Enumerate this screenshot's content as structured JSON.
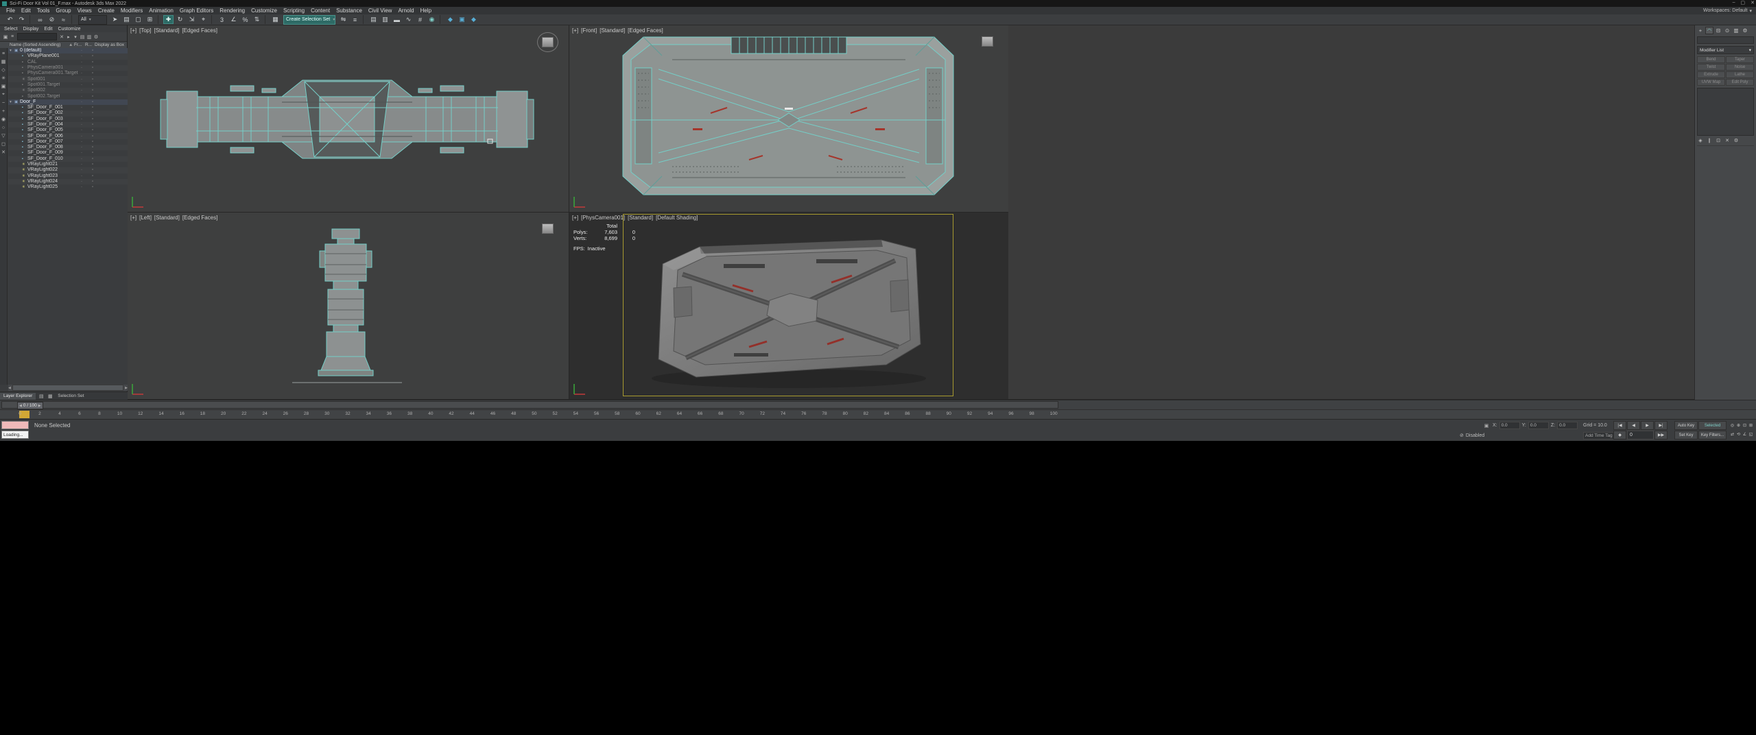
{
  "window": {
    "title": "Sci-Fi Door Kit Vol 01_F.max - Autodesk 3ds Max 2022",
    "min_btn": "–",
    "max_btn": "▢",
    "close_btn": "✕"
  },
  "menubar": {
    "items": [
      "File",
      "Edit",
      "Tools",
      "Group",
      "Views",
      "Create",
      "Modifiers",
      "Animation",
      "Graph Editors",
      "Rendering",
      "Customize",
      "Scripting",
      "Content",
      "Substance",
      "Civil View",
      "Arnold",
      "Help"
    ],
    "workspaces": "Workspaces: Default",
    "workspaces_arrow": "▾"
  },
  "toolbar": {
    "icons_a": [
      {
        "dn": "undo-icon",
        "g": "↶"
      },
      {
        "dn": "redo-icon",
        "g": "↷"
      },
      {
        "dn": "separator",
        "g": "",
        "cls": "sep"
      },
      {
        "dn": "select-and-link-icon",
        "g": "∞"
      },
      {
        "dn": "unlink-selection-icon",
        "g": "⊘"
      },
      {
        "dn": "bind-to-spacewarp-icon",
        "g": "≈"
      },
      {
        "dn": "separator",
        "g": "",
        "cls": "sep"
      }
    ],
    "filter_combo": "All",
    "combo_arrow": "▾",
    "icons_b": [
      {
        "dn": "select-object-icon",
        "g": "➤"
      },
      {
        "dn": "select-by-name-icon",
        "g": "▤"
      },
      {
        "dn": "rectangular-selection-icon",
        "g": "▢"
      },
      {
        "dn": "window-crossing-icon",
        "g": "⊞"
      },
      {
        "dn": "separator",
        "g": "",
        "cls": "sep"
      },
      {
        "dn": "select-and-move-icon",
        "g": "✚",
        "cls": "act"
      },
      {
        "dn": "select-and-rotate-icon",
        "g": "↻"
      },
      {
        "dn": "select-and-scale-icon",
        "g": "⇲"
      },
      {
        "dn": "select-and-place-icon",
        "g": "⌖"
      },
      {
        "dn": "separator",
        "g": "",
        "cls": "sep"
      },
      {
        "dn": "snap-toggle-3d-icon",
        "g": "3"
      },
      {
        "dn": "angle-snap-icon",
        "g": "∠"
      },
      {
        "dn": "percent-snap-icon",
        "g": "%"
      },
      {
        "dn": "spinner-snap-icon",
        "g": "⇅"
      },
      {
        "dn": "separator",
        "g": "",
        "cls": "sep"
      },
      {
        "dn": "edit-named-sets-icon",
        "g": "▦"
      }
    ],
    "selset_combo": "Create Selection Set",
    "icons_c": [
      {
        "dn": "mirror-icon",
        "g": "⇋"
      },
      {
        "dn": "align-icon",
        "g": "≡"
      },
      {
        "dn": "separator",
        "g": "",
        "cls": "sep"
      },
      {
        "dn": "scene-explorer-toggle-icon",
        "g": "▤"
      },
      {
        "dn": "layer-explorer-toggle-icon",
        "g": "▥"
      },
      {
        "dn": "ribbon-toggle-icon",
        "g": "▬"
      },
      {
        "dn": "curve-editor-icon",
        "g": "∿"
      },
      {
        "dn": "schematic-view-icon",
        "g": "#"
      },
      {
        "dn": "material-editor-icon",
        "g": "◉",
        "cls": "mat"
      },
      {
        "dn": "separator",
        "g": "",
        "cls": "sep"
      },
      {
        "dn": "render-setup-icon",
        "g": "◆",
        "cls": "rend"
      },
      {
        "dn": "rendered-frame-icon",
        "g": "▣",
        "cls": "rend"
      },
      {
        "dn": "render-production-icon",
        "g": "◆",
        "cls": "rend"
      }
    ]
  },
  "explorer": {
    "menu": [
      "Select",
      "Display",
      "Edit",
      "Customize"
    ],
    "tool_icons_pre": [
      {
        "dn": "explorer-lock-icon",
        "g": "▣"
      },
      {
        "dn": "explorer-sync-icon",
        "g": "≡"
      }
    ],
    "search_value": "",
    "tool_icons_post": [
      {
        "dn": "clear-search-icon",
        "g": "✕"
      },
      {
        "dn": "explorer-expand-icon",
        "g": "▸"
      },
      {
        "dn": "explorer-collapse-icon",
        "g": "▾"
      },
      {
        "dn": "explorer-view-icon",
        "g": "▤"
      },
      {
        "dn": "explorer-columns-icon",
        "g": "▥"
      },
      {
        "dn": "explorer-settings-icon",
        "g": "⚙"
      }
    ],
    "columns": {
      "name": "Name (Sorted Ascending)",
      "sort_arrow": "▲",
      "frozen": "Fr...",
      "render": "R...",
      "display": "Display as Box"
    },
    "side_icons": [
      {
        "dn": "display-all-icon",
        "g": "≡"
      },
      {
        "dn": "display-geometry-icon",
        "g": "▦"
      },
      {
        "dn": "display-shapes-icon",
        "g": "◇"
      },
      {
        "dn": "display-lights-icon",
        "g": "✳"
      },
      {
        "dn": "display-cameras-icon",
        "g": "▣"
      },
      {
        "dn": "display-helpers-icon",
        "g": "⌖"
      },
      {
        "dn": "display-spacewarps-icon",
        "g": "~"
      },
      {
        "dn": "display-groups-icon",
        "g": "+"
      },
      {
        "dn": "display-xrefs-icon",
        "g": "◉"
      },
      {
        "dn": "display-bones-icon",
        "g": "○"
      },
      {
        "dn": "display-containers-icon",
        "g": "▽"
      },
      {
        "dn": "display-materials-icon",
        "g": "◻"
      },
      {
        "dn": "display-none-icon",
        "g": "✕"
      }
    ],
    "rows": [
      {
        "name": "0 (default)",
        "cls": "lay",
        "arrow": "▾",
        "icon": "▣",
        "dn": "layer-row"
      },
      {
        "name": "VRayPlane001",
        "cls": "ind geo",
        "icon": "▪",
        "dn": "object-row"
      },
      {
        "name": "CAL",
        "cls": "ind dim",
        "icon": "▪",
        "dn": "object-row"
      },
      {
        "name": "PhysCamera001",
        "cls": "ind dim",
        "icon": "▪",
        "dn": "object-row"
      },
      {
        "name": "PhysCamera001.Target",
        "cls": "ind dim",
        "icon": "▪",
        "dn": "object-row"
      },
      {
        "name": "Spot001",
        "cls": "ind dim",
        "icon": "✳",
        "dn": "object-row"
      },
      {
        "name": "Spot001.Target",
        "cls": "ind dim",
        "icon": "▪",
        "dn": "object-row"
      },
      {
        "name": "Spot002",
        "cls": "ind dim",
        "icon": "✳",
        "dn": "object-row"
      },
      {
        "name": "Spot002.Target",
        "cls": "ind dim",
        "icon": "▪",
        "dn": "object-row"
      },
      {
        "name": "Door_F",
        "cls": "lay",
        "arrow": "▾",
        "icon": "▣",
        "dn": "layer-row"
      },
      {
        "name": "SF_Door_F_001",
        "cls": "ind geo",
        "icon": "▪",
        "dn": "object-row"
      },
      {
        "name": "SF_Door_F_002",
        "cls": "ind geo",
        "icon": "▪",
        "dn": "object-row"
      },
      {
        "name": "SF_Door_F_003",
        "cls": "ind geo",
        "icon": "▪",
        "dn": "object-row"
      },
      {
        "name": "SF_Door_F_004",
        "cls": "ind geo",
        "icon": "▪",
        "dn": "object-row"
      },
      {
        "name": "SF_Door_F_005",
        "cls": "ind geo",
        "icon": "▪",
        "dn": "object-row"
      },
      {
        "name": "SF_Door_F_006",
        "cls": "ind geo",
        "icon": "▪",
        "dn": "object-row"
      },
      {
        "name": "SF_Door_F_007",
        "cls": "ind geo",
        "icon": "▪",
        "dn": "object-row"
      },
      {
        "name": "SF_Door_F_008",
        "cls": "ind geo",
        "icon": "▪",
        "dn": "object-row"
      },
      {
        "name": "SF_Door_F_009",
        "cls": "ind geo",
        "icon": "▪",
        "dn": "object-row"
      },
      {
        "name": "SF_Door_F_010",
        "cls": "ind geo",
        "icon": "▪",
        "dn": "object-row"
      },
      {
        "name": "VRayLight021",
        "cls": "ind lig",
        "icon": "✳",
        "dn": "object-row"
      },
      {
        "name": "VRayLight022",
        "cls": "ind lig",
        "icon": "✳",
        "dn": "object-row"
      },
      {
        "name": "VRayLight023",
        "cls": "ind lig",
        "icon": "✳",
        "dn": "object-row"
      },
      {
        "name": "VRayLight024",
        "cls": "ind lig",
        "icon": "✳",
        "dn": "object-row"
      },
      {
        "name": "VRayLight025",
        "cls": "ind lig",
        "icon": "✳",
        "dn": "object-row"
      }
    ],
    "cell_frozen_glyph": "·",
    "cell_display_glyph": "▫",
    "scroll_left": "◀",
    "scroll_right": "▶",
    "tabs": {
      "layer_explorer": "Layer Explorer",
      "selection_set": "Selection Set"
    },
    "tab_icons": [
      {
        "dn": "explorer-list-icon",
        "g": "▤"
      },
      {
        "dn": "explorer-grid-icon",
        "g": "▦"
      }
    ]
  },
  "viewports": {
    "top": {
      "plus": "[+]",
      "view": "[Top]",
      "style": "[Standard]",
      "shading": "[Edged Faces]"
    },
    "front": {
      "plus": "[+]",
      "view": "[Front]",
      "style": "[Standard]",
      "shading": "[Edged Faces]"
    },
    "left": {
      "plus": "[+]",
      "view": "[Left]",
      "style": "[Standard]",
      "shading": "[Edged Faces]"
    },
    "camera": {
      "plus": "[+]",
      "view": "[PhysCamera001]",
      "style": "[Standard]",
      "shading": "[Default Shading]",
      "stats": {
        "total_label": "Total",
        "polys_label": "Polys:",
        "polys_total": "7,603",
        "polys_sel": "0",
        "verts_label": "Verts:",
        "verts_total": "8,699",
        "verts_sel": "0",
        "fps_label": "FPS:",
        "fps_value": "Inactive"
      }
    }
  },
  "command_panel": {
    "tabs": [
      {
        "dn": "tab-create",
        "g": "+"
      },
      {
        "dn": "tab-modify",
        "g": "◠",
        "cls": "active"
      },
      {
        "dn": "tab-hierarchy",
        "g": "⊟"
      },
      {
        "dn": "tab-motion",
        "g": "⊙"
      },
      {
        "dn": "tab-display",
        "g": "▥"
      },
      {
        "dn": "tab-utilities",
        "g": "⚙"
      }
    ],
    "modifier_list_label": "Modifier List",
    "modifier_list_arrow": "▾",
    "buttons": [
      "Bend",
      "Taper",
      "Twist",
      "Noise",
      "Extrude",
      "Lathe",
      "UVW Map",
      "Edit Poly"
    ],
    "stack_icons": [
      {
        "dn": "pin-stack-icon",
        "g": "◈"
      },
      {
        "dn": "show-end-result-icon",
        "g": "∥"
      },
      {
        "dn": "make-unique-icon",
        "g": "⊡"
      },
      {
        "dn": "remove-modifier-icon",
        "g": "✕"
      },
      {
        "dn": "configure-modifier-sets-icon",
        "g": "⚙"
      }
    ]
  },
  "timeline": {
    "slider_label": "0 / 100",
    "slider_left_arrow": "◀",
    "slider_right_arrow": "▶",
    "ticks": [
      "0",
      "2",
      "4",
      "6",
      "8",
      "10",
      "12",
      "14",
      "16",
      "18",
      "20",
      "22",
      "24",
      "26",
      "28",
      "30",
      "32",
      "34",
      "36",
      "38",
      "40",
      "42",
      "44",
      "46",
      "48",
      "50",
      "52",
      "54",
      "56",
      "58",
      "60",
      "62",
      "64",
      "66",
      "68",
      "70",
      "72",
      "74",
      "76",
      "78",
      "80",
      "82",
      "84",
      "86",
      "88",
      "90",
      "92",
      "94",
      "96",
      "98",
      "100"
    ]
  },
  "status": {
    "prompt": "None Selected",
    "listener_text": "Loading...",
    "lock_glyph": "▣",
    "x_label": "X:",
    "x_value": "0.0",
    "y_label": "Y:",
    "y_value": "0.0",
    "z_label": "Z:",
    "z_value": "0.0",
    "grid_label": "Grid = 10.0",
    "degradation_glyph": "⊘",
    "degradation_label": "Disabled",
    "add_time_tag": "Add Time Tag",
    "transport": [
      {
        "dn": "go-to-start-button",
        "g": "|◀"
      },
      {
        "dn": "previous-frame-button",
        "g": "◀"
      },
      {
        "dn": "play-button",
        "g": "▶"
      },
      {
        "dn": "next-frame-button",
        "g": "▶|"
      }
    ],
    "frame_value": "0",
    "transport2": [
      {
        "dn": "key-mode-toggle",
        "g": "◆"
      },
      {
        "dn": "go-to-end-button",
        "g": "▶▶"
      }
    ],
    "auto_key": "Auto Key",
    "key_selected": "Selected",
    "set_key": "Set Key",
    "key_filters": "Key Filters...",
    "nav_icons": [
      {
        "dn": "zoom-icon",
        "g": "◎"
      },
      {
        "dn": "zoom-all-icon",
        "g": "⊕"
      },
      {
        "dn": "zoom-extents-icon",
        "g": "⊡"
      },
      {
        "dn": "zoom-extents-all-icon",
        "g": "⊞"
      },
      {
        "dn": "pan-icon",
        "g": "⇄"
      },
      {
        "dn": "orbit-icon",
        "g": "⟲"
      },
      {
        "dn": "fov-icon",
        "g": "∠"
      },
      {
        "dn": "maximize-viewport-icon",
        "g": "◱"
      }
    ]
  }
}
